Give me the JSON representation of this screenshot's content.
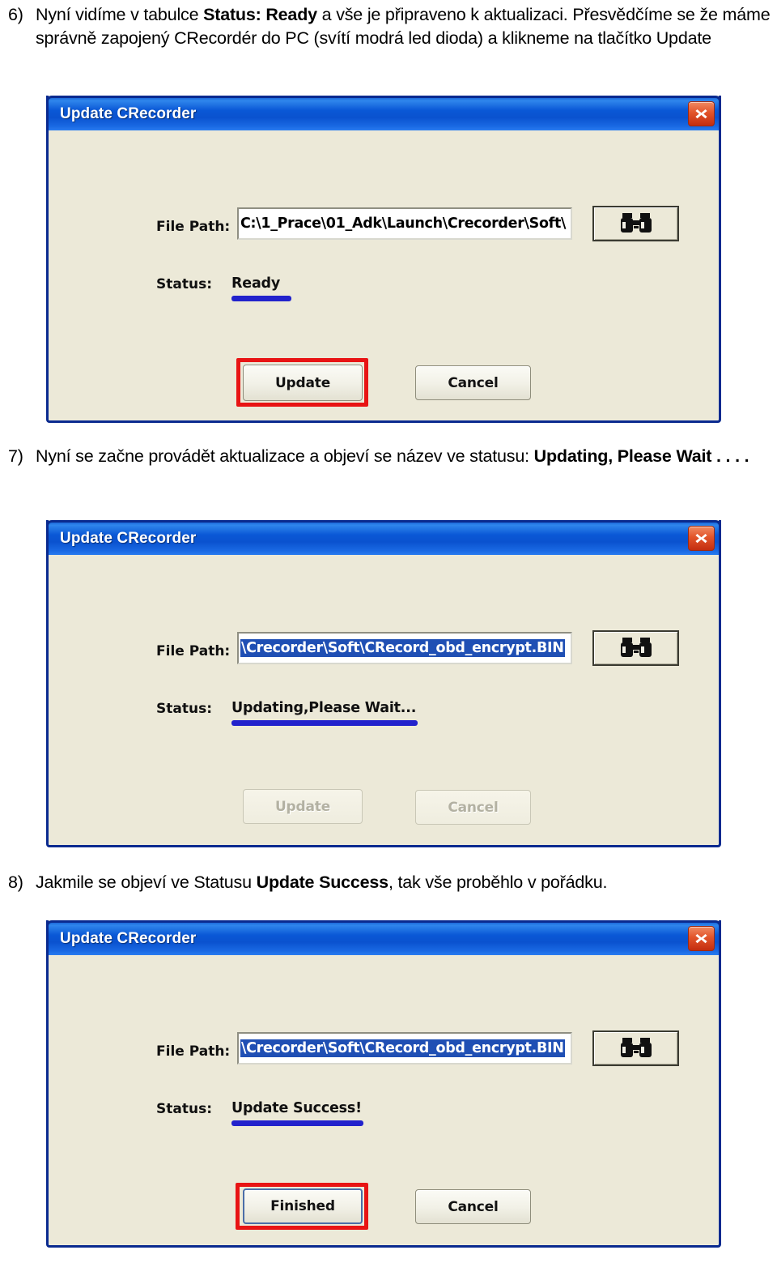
{
  "document": {
    "language": "cs",
    "steps": [
      {
        "number": "6)",
        "segments": [
          {
            "text": "Nyní vidíme v tabulce ",
            "bold": false
          },
          {
            "text": "Status: Ready",
            "bold": true
          },
          {
            "text": " a vše je připraveno k aktualizaci. Přesvědčíme se že máme správně zapojený CRecordér do PC (svítí modrá led dioda) a klikneme na tlačítko Update",
            "bold": false
          }
        ]
      },
      {
        "number": "7)",
        "segments": [
          {
            "text": "Nyní se začne provádět aktualizace a objeví se název ve statusu: ",
            "bold": false
          },
          {
            "text": "Updating, Please Wait . . . .",
            "bold": true
          }
        ]
      },
      {
        "number": "8)",
        "segments": [
          {
            "text": "Jakmile se objeví ve Statusu ",
            "bold": false
          },
          {
            "text": "Update Success",
            "bold": true
          },
          {
            "text": ", tak vše proběhlo v pořádku.",
            "bold": false
          }
        ]
      }
    ]
  },
  "dialogs": [
    {
      "id": "dialog-ready",
      "title": "Update CRecorder",
      "close_icon": "close-icon",
      "file_path_label": "File Path:",
      "file_path_value": "C:\\1_Prace\\01_Adk\\Launch\\Crecorder\\Soft\\",
      "file_path_selected": false,
      "browse_icon": "binoculars-icon",
      "status_label": "Status:",
      "status_value": "Ready",
      "status_underline_color": "#2222cc",
      "primary_button": "Update",
      "primary_disabled": false,
      "primary_highlighted": true,
      "primary_focused": false,
      "secondary_button": "Cancel",
      "secondary_disabled": false
    },
    {
      "id": "dialog-updating",
      "title": "Update CRecorder",
      "close_icon": "close-icon",
      "file_path_label": "File Path:",
      "file_path_value": "\\Crecorder\\Soft\\CRecord_obd_encrypt.BIN",
      "file_path_selected": true,
      "browse_icon": "binoculars-icon",
      "status_label": "Status:",
      "status_value": "Updating,Please Wait...",
      "status_underline_color": "#2222cc",
      "primary_button": "Update",
      "primary_disabled": true,
      "primary_highlighted": false,
      "primary_focused": false,
      "secondary_button": "Cancel",
      "secondary_disabled": true
    },
    {
      "id": "dialog-success",
      "title": "Update CRecorder",
      "close_icon": "close-icon",
      "file_path_label": "File Path:",
      "file_path_value": "\\Crecorder\\Soft\\CRecord_obd_encrypt.BIN",
      "file_path_selected": true,
      "browse_icon": "binoculars-icon",
      "status_label": "Status:",
      "status_value": "Update Success!",
      "status_underline_color": "#2222cc",
      "primary_button": "Finished",
      "primary_disabled": false,
      "primary_highlighted": true,
      "primary_focused": true,
      "secondary_button": "Cancel",
      "secondary_disabled": false
    }
  ],
  "colors": {
    "dialog_face": "#ece9d8",
    "titlebar_blue": "#0a58d6",
    "dialog_border": "#0a2a8f",
    "highlight_red": "#e81414",
    "selection_blue": "#1f4fb4",
    "status_underline": "#2222cc",
    "close_button_red": "#c32d10"
  }
}
